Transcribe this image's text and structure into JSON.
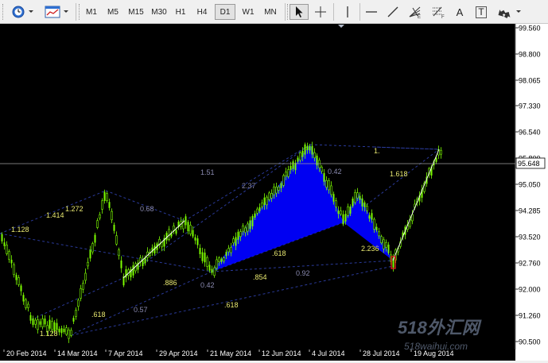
{
  "toolbar": {
    "timeframes": [
      "M1",
      "M5",
      "M15",
      "M30",
      "H1",
      "H4",
      "D1",
      "W1",
      "MN"
    ],
    "active_timeframe": "D1",
    "tools": [
      "cursor-arrow",
      "crosshair",
      "vertical-line",
      "horizontal-line",
      "trendline",
      "fibonacci-fan",
      "fibonacci-retracement",
      "text-label",
      "text-box",
      "arrows-dropdown"
    ],
    "text_tool_glyph": "A",
    "textbox_tool_glyph": "T"
  },
  "price_axis": {
    "labels": [
      "99.560",
      "98.800",
      "98.065",
      "97.330",
      "96.540",
      "95.800",
      "95.050",
      "94.285",
      "93.520",
      "92.760",
      "92.000",
      "91.260",
      "90.500"
    ],
    "current_price": "95.648"
  },
  "time_axis": {
    "labels": [
      "20 Feb 2014",
      "14 Mar 2014",
      "7 Apr 2014",
      "29 Apr 2014",
      "21 May 2014",
      "12 Jun 2014",
      "4 Jul 2014",
      "28 Jul 2014",
      "19 Aug 2014"
    ]
  },
  "pattern_labels": [
    "1.128",
    "1.414",
    "1.272",
    "0.68",
    "1.51",
    "2.37",
    "0.42",
    "1.",
    "1.618",
    ".886",
    "0.42",
    ".618",
    ".854",
    "0.92",
    "2.236",
    ".618",
    "0.57",
    ".618",
    "1.128"
  ],
  "watermark": {
    "text": "518外汇网",
    "url": "518waihui.com"
  },
  "colors": {
    "background": "#000000",
    "bull_candle": "#7cfc00",
    "pattern_fill": "#0000ff",
    "fib_line": "#2a3a9a",
    "label_yellow": "#e8e870",
    "label_gray": "#8a8ab0",
    "price_line": "#a0a0a0"
  }
}
